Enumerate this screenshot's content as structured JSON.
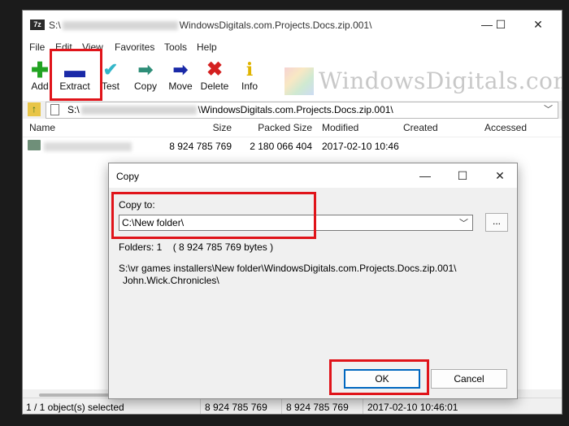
{
  "window": {
    "app_icon_text": "7z",
    "title_prefix": "S:\\",
    "title_suffix": "WindowsDigitals.com.Projects.Docs.zip.001\\",
    "controls": {
      "minimize": "—",
      "maximize": "☐",
      "close": "✕"
    }
  },
  "menu": [
    "File",
    "Edit",
    "View",
    "Favorites",
    "Tools",
    "Help"
  ],
  "toolbar": {
    "add": "Add",
    "extract": "Extract",
    "test": "Test",
    "copy": "Copy",
    "move": "Move",
    "delete": "Delete",
    "info": "Info"
  },
  "watermark": "WindowsDigitals.com",
  "address": {
    "prefix": "S:\\",
    "suffix": "\\WindowsDigitals.com.Projects.Docs.zip.001\\"
  },
  "columns": {
    "name": "Name",
    "size": "Size",
    "packed": "Packed Size",
    "modified": "Modified",
    "created": "Created",
    "accessed": "Accessed"
  },
  "rows": [
    {
      "size": "8 924 785 769",
      "packed": "2 180 066 404",
      "modified": "2017-02-10 10:46"
    }
  ],
  "status": {
    "selected": "1 / 1 object(s) selected",
    "size": "8 924 785 769",
    "packed": "8 924 785 769",
    "modified": "2017-02-10 10:46:01"
  },
  "dialog": {
    "title": "Copy",
    "controls": {
      "minimize": "—",
      "maximize": "☐",
      "close": "✕"
    },
    "copy_to_label": "Copy to:",
    "path_value": "C:\\New folder\\",
    "browse": "...",
    "folders_info": "Folders: 1    ( 8 924 785 769 bytes )",
    "dest_line1": "S:\\vr games installers\\New folder\\WindowsDigitals.com.Projects.Docs.zip.001\\",
    "dest_line2": "John.Wick.Chronicles\\",
    "ok": "OK",
    "cancel": "Cancel"
  },
  "colors": {
    "highlight": "#e0141a",
    "ok_border": "#0067c0",
    "add_icon": "#22a322",
    "extract_icon": "#1a2aa8",
    "test_icon": "#33b6c9",
    "copy_icon": "#2e8e78",
    "move_icon": "#1a2aa8",
    "delete_icon": "#d42020",
    "info_icon": "#e0b400"
  }
}
